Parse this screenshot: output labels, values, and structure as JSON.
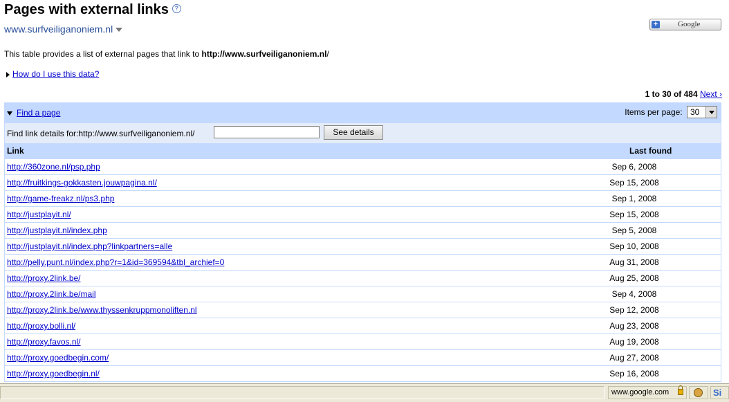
{
  "page": {
    "title": "Pages with external links",
    "help_icon": "?",
    "site": "www.surfveiliganoniem.nl",
    "google_button": "Google",
    "google_plus": "+",
    "intro_prefix": "This table provides a list of external pages that link to ",
    "intro_url": "http://www.surfveiliganoniem.nl",
    "intro_suffix": "/",
    "howto_link": "How do I use this data?"
  },
  "pager": {
    "range": "1 to 30 of 484",
    "next": "Next ›"
  },
  "find": {
    "toggle_label": "Find a page",
    "items_per_page_label": "Items per page:",
    "items_per_page_value": "30",
    "find_label": "Find link details for:http://www.surfveiliganoniem.nl/",
    "input_value": "",
    "button_label": "See details"
  },
  "table": {
    "headers": [
      "Link",
      "Last found"
    ],
    "rows": [
      {
        "link": "http://360zone.nl/psp.php",
        "date": "Sep 6, 2008"
      },
      {
        "link": "http://fruitkings-gokkasten.jouwpagina.nl/",
        "date": "Sep 15, 2008"
      },
      {
        "link": "http://game-freakz.nl/ps3.php",
        "date": "Sep 1, 2008"
      },
      {
        "link": "http://justplayit.nl/",
        "date": "Sep 15, 2008"
      },
      {
        "link": "http://justplayit.nl/index.php",
        "date": "Sep 5, 2008"
      },
      {
        "link": "http://justplayit.nl/index.php?linkpartners=alle",
        "date": "Sep 10, 2008"
      },
      {
        "link": "http://pelly.punt.nl/index.php?r=1&id=369594&tbl_archief=0",
        "date": "Aug 31, 2008"
      },
      {
        "link": "http://proxy.2link.be/",
        "date": "Aug 25, 2008"
      },
      {
        "link": "http://proxy.2link.be/mail",
        "date": "Sep 4, 2008"
      },
      {
        "link": "http://proxy.2link.be/www.thyssenkruppmonoliften.nl",
        "date": "Sep 12, 2008"
      },
      {
        "link": "http://proxy.bolli.nl/",
        "date": "Aug 23, 2008"
      },
      {
        "link": "http://proxy.favos.nl/",
        "date": "Aug 19, 2008"
      },
      {
        "link": "http://proxy.goedbegin.com/",
        "date": "Aug 27, 2008"
      },
      {
        "link": "http://proxy.goedbegin.nl/",
        "date": "Sep 16, 2008"
      }
    ]
  },
  "statusbar": {
    "domain": "www.google.com",
    "right_text": "Si"
  }
}
